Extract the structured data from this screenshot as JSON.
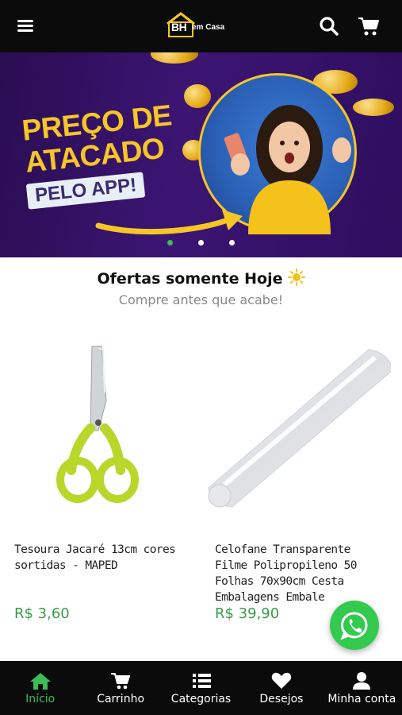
{
  "header": {
    "menu_icon": "hamburger-menu-icon",
    "logo": {
      "brand": "BH",
      "suffix": "em Casa"
    },
    "search_icon": "search-icon",
    "cart_icon": "shopping-cart-icon"
  },
  "banner": {
    "line1": "PREÇO DE",
    "line2": "ATACADO",
    "tag": "PELO APP!",
    "slides": 3,
    "active_slide": 1,
    "colors": {
      "background": "#3c1573",
      "accent": "#f6c626"
    }
  },
  "section": {
    "title": "Ofertas somente Hoje",
    "title_icon": "sun-icon",
    "subtitle": "Compre antes que acabe!"
  },
  "products": [
    {
      "name": "Tesoura Jacaré 13cm cores sortidas - MAPED",
      "price": "R$ 3,60",
      "image_icon": "scissors-image"
    },
    {
      "name": "Celofane Transparente Filme Polipropileno 50 Folhas 70x90cm Cesta Embalagens Embale",
      "price": "R$ 39,90",
      "image_icon": "cellophane-roll-image"
    }
  ],
  "whatsapp": {
    "icon": "whatsapp-icon",
    "color": "#34c94f"
  },
  "bottom_nav": [
    {
      "label": "Início",
      "icon": "home-icon",
      "active": true
    },
    {
      "label": "Carrinho",
      "icon": "cart-icon",
      "active": false
    },
    {
      "label": "Categorias",
      "icon": "list-icon",
      "active": false
    },
    {
      "label": "Desejos",
      "icon": "heart-icon",
      "active": false
    },
    {
      "label": "Minha conta",
      "icon": "user-icon",
      "active": false
    }
  ],
  "colors": {
    "price": "#3a9a48",
    "active_nav": "#3dbd56",
    "header_bg": "#0b0b0b"
  }
}
